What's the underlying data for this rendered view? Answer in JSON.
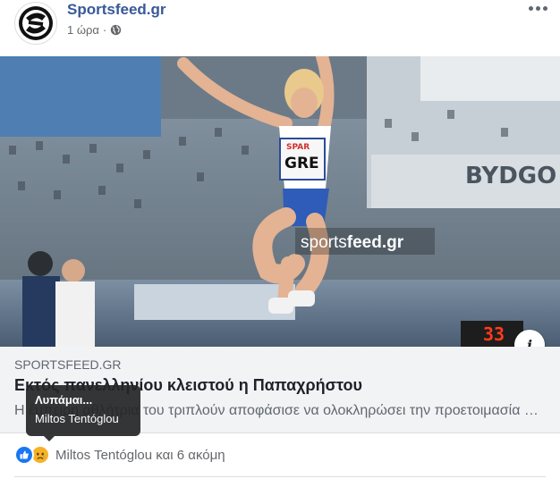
{
  "header": {
    "page_name": "Sportsfeed.gr",
    "time": "1 ώρα",
    "separator": "·",
    "avatar_icon": "sportsfeed-logo",
    "privacy_icon": "globe-icon",
    "more_icon": "more-dots-icon"
  },
  "photo": {
    "bib_country": "GRE",
    "bib_sponsor": "SPAR",
    "watermark_prefix": "sports",
    "watermark_suffix": "feed.gr",
    "venue_sign": "BYDGO",
    "scoreboard": "33"
  },
  "link": {
    "domain": "sportsfeed.gr",
    "headline": "Εκτός πανελληνίου κλειστού η Παπαχρήστου",
    "description": "Η έμπειρη αθλήτρια του τριπλούν αποφάσισε να ολοκληρώσει την προετοιμασία της",
    "info_icon": "info-icon"
  },
  "tooltip": {
    "title": "Λυπάμαι...",
    "name": "Miltos Tentóglou"
  },
  "reactions": {
    "summary": "Miltos Tentóglou και 6 ακόμη",
    "icons": [
      "like-icon",
      "sad-icon"
    ]
  },
  "colors": {
    "page_link": "#385898",
    "like": "#1877f2",
    "sad": "#f7b125",
    "link_box": "#f2f3f5"
  }
}
